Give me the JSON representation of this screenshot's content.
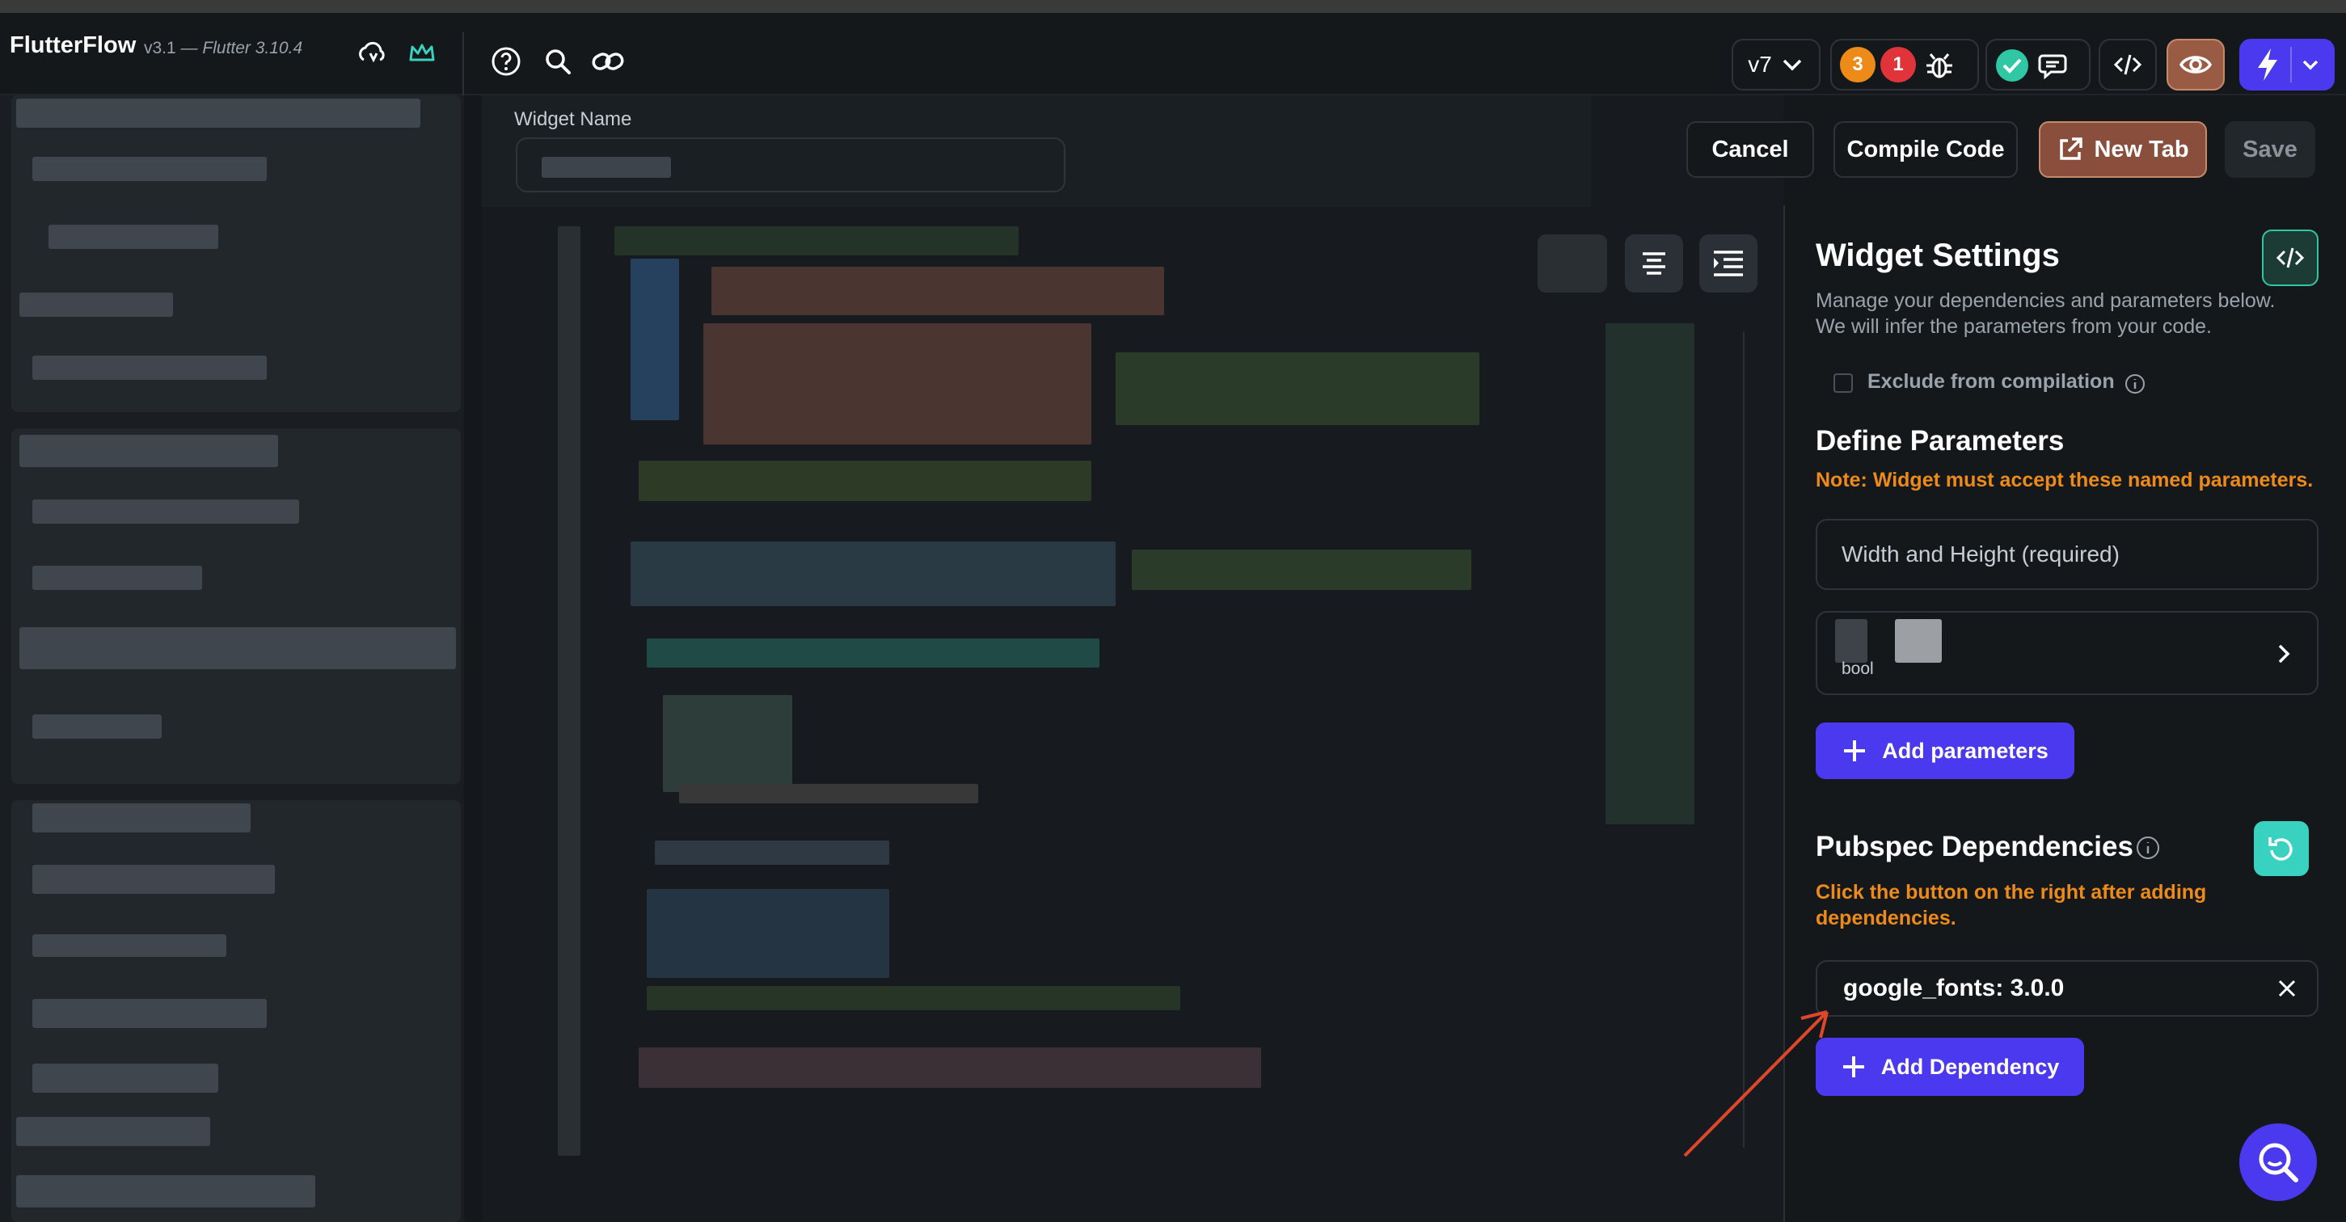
{
  "app": {
    "name": "FlutterFlow",
    "version": "v3.1",
    "flutter_version": "Flutter 3.10.4",
    "version_select": "v7",
    "warning_count": "3",
    "error_count": "1"
  },
  "icons": {
    "cloud": "cloud-sync-icon",
    "crown": "crown-icon",
    "help": "help-icon",
    "search": "search-icon",
    "link": "link-icon",
    "chevron": "chevron-down-icon",
    "bug": "bug-icon",
    "check": "check-circle-icon",
    "chat": "chat-icon",
    "code": "code-icon",
    "preview": "eye-icon",
    "lightning": "lightning-icon"
  },
  "editor": {
    "widget_name_label": "Widget Name",
    "cancel": "Cancel",
    "compile": "Compile Code",
    "new_tab": "New Tab",
    "save": "Save"
  },
  "settings": {
    "title": "Widget Settings",
    "description_1": "Manage your dependencies and parameters below.",
    "description_2": "We will infer the parameters from your code.",
    "exclude_label": "Exclude from compilation",
    "define_title": "Define Parameters",
    "define_note": "Note: Widget must accept these named parameters.",
    "width_height": "Width and Height (required)",
    "param_type": "bool",
    "add_parameters": "Add parameters",
    "pubspec_title": "Pubspec Dependencies",
    "pubspec_note_1": "Click the button on the right after adding",
    "pubspec_note_2": "dependencies.",
    "dependency": "google_fonts: 3.0.0",
    "add_dependency": "Add Dependency"
  },
  "colors": {
    "accent_purple": "#4b39ef",
    "accent_teal": "#39d2c0",
    "warning_orange": "#ee8b18",
    "new_tab_border": "#c58a6a",
    "annotation_red": "#e0472a"
  }
}
